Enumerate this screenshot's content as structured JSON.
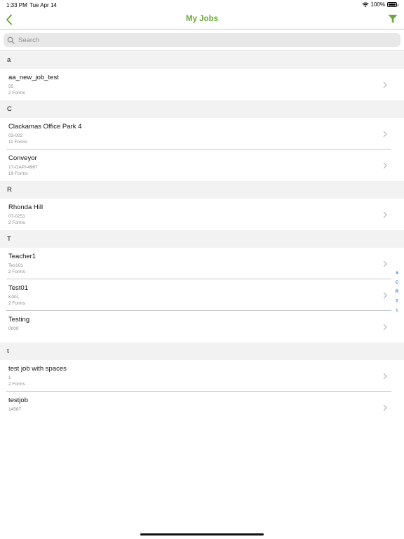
{
  "colors": {
    "accent": "#6aaa3a",
    "index": "#2b7de0"
  },
  "status_bar": {
    "time": "1:33 PM",
    "date": "Tue Apr 14",
    "battery": "100%"
  },
  "nav": {
    "title": "My Jobs"
  },
  "search": {
    "placeholder": "Search"
  },
  "sections": [
    {
      "letter": "a",
      "jobs": [
        {
          "name": "aa_new_job_test",
          "code": "55",
          "forms": "2 Forms"
        }
      ]
    },
    {
      "letter": "C",
      "jobs": [
        {
          "name": "Clackamas Office Park 4",
          "code": "03-002",
          "forms": "11 Forms"
        },
        {
          "name": "Conveyor",
          "code": "17-GAPI-4967",
          "forms": "19 Forms"
        }
      ]
    },
    {
      "letter": "R",
      "jobs": [
        {
          "name": "Rhonda Hill",
          "code": "07-0251",
          "forms": "2 Forms"
        }
      ]
    },
    {
      "letter": "T",
      "jobs": [
        {
          "name": "Teacher1",
          "code": "Tes101",
          "forms": "2 Forms"
        },
        {
          "name": "Test01",
          "code": "K001",
          "forms": "2 Forms"
        },
        {
          "name": "Testing",
          "code": "0000",
          "forms": ""
        }
      ]
    },
    {
      "letter": "t",
      "jobs": [
        {
          "name": "test job with spaces",
          "code": "1",
          "forms": "2 Forms"
        },
        {
          "name": "testjob",
          "code": "14587",
          "forms": ""
        }
      ]
    }
  ],
  "index": [
    "a",
    "C",
    "R",
    "T",
    "t"
  ]
}
